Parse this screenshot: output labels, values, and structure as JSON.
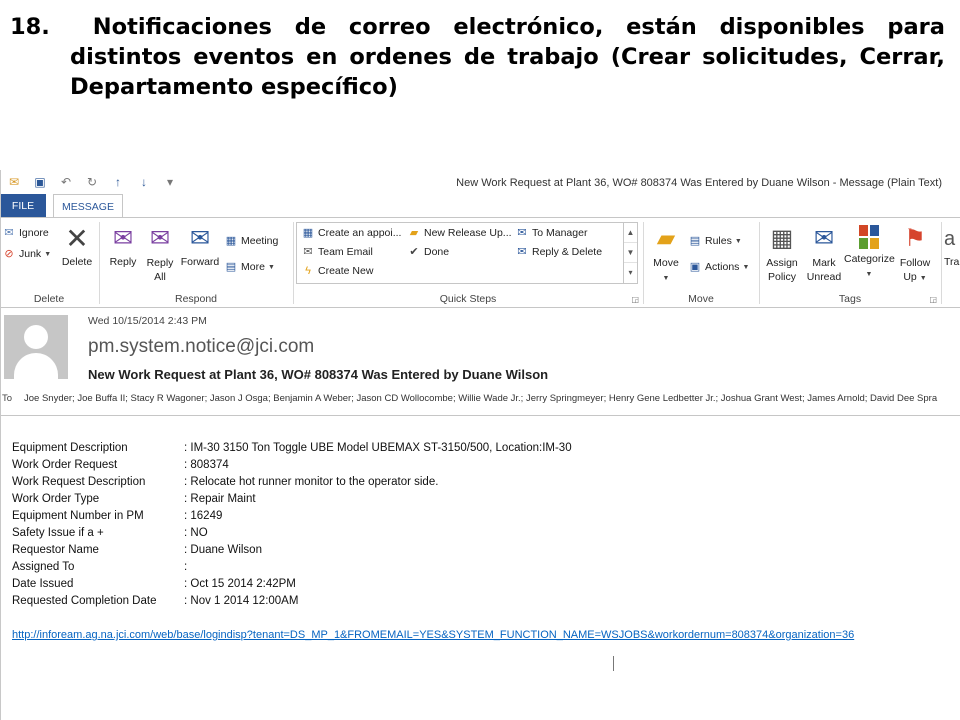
{
  "slide": {
    "line1": [
      "18.",
      "Notificaciones",
      "de",
      "correo",
      "electrónico,",
      "están",
      "disponibles",
      "para"
    ],
    "line2": [
      "distintos",
      "eventos",
      "en",
      "ordenes",
      "de",
      "trabajo",
      "(Crear",
      "solicitudes,",
      "Cerrar,"
    ],
    "line3": "Departamento específico)"
  },
  "window": {
    "title": "New Work Request at Plant 36, WO# 808374 Was Entered by Duane Wilson - Message (Plain Text)"
  },
  "tabs": {
    "file": "FILE",
    "message": "MESSAGE"
  },
  "ribbon": {
    "delete_group": {
      "label": "Delete",
      "ignore": "Ignore",
      "junk": "Junk",
      "delete": "Delete"
    },
    "respond_group": {
      "label": "Respond",
      "reply": "Reply",
      "reply_all_1": "Reply",
      "reply_all_2": "All",
      "forward": "Forward",
      "meeting": "Meeting",
      "more": "More"
    },
    "quick_steps": {
      "label": "Quick Steps",
      "items": [
        "Create an appoi...",
        "Team Email",
        "Create New",
        "New Release Up...",
        "Done",
        "To Manager",
        "Reply & Delete"
      ]
    },
    "move_group": {
      "label": "Move",
      "move": "Move",
      "rules": "Rules",
      "actions": "Actions"
    },
    "tags_group": {
      "label": "Tags",
      "assign_1": "Assign",
      "assign_2": "Policy",
      "mark_1": "Mark",
      "mark_2": "Unread",
      "categorize": "Categorize",
      "follow_1": "Follow",
      "follow_2": "Up",
      "tra": "Tra"
    }
  },
  "message": {
    "date": "Wed 10/15/2014 2:43 PM",
    "from": "pm.system.notice@jci.com",
    "subject": "New Work Request at Plant 36, WO# 808374 Was Entered by Duane Wilson",
    "to_label": "To",
    "to": "Joe Snyder; Joe Buffa II; Stacy R Wagoner; Jason J Osga; Benjamin A Weber; Jason CD Wollocombe; Willie Wade Jr.; Jerry Springmeyer; Henry Gene Ledbetter Jr.; Joshua Grant West; James Arnold; David Dee Spra"
  },
  "body": {
    "fields": [
      {
        "label": "Equipment Description",
        "value": ": IM-30 3150 Ton Toggle UBE Model UBEMAX ST-3150/500, Location:IM-30"
      },
      {
        "label": "Work Order Request",
        "value": ": 808374"
      },
      {
        "label": "Work Request Description",
        "value": ": Relocate hot runner monitor to the operator side."
      },
      {
        "label": "Work Order Type",
        "value": ": Repair Maint"
      },
      {
        "label": "Equipment Number in PM",
        "value": ": 16249"
      },
      {
        "label": "Safety Issue if a +",
        "value": ": NO"
      },
      {
        "label": "Requestor Name",
        "value": ": Duane Wilson"
      },
      {
        "label": "Assigned To",
        "value": ":"
      },
      {
        "label": "Date Issued",
        "value": ": Oct 15 2014  2:42PM"
      },
      {
        "label": "Requested Completion Date",
        "value": ": Nov  1 2014 12:00AM"
      }
    ],
    "link": "http://infoream.ag.na.jci.com/web/base/logindisp?tenant=DS_MP_1&FROMEMAIL=YES&SYSTEM_FUNCTION_NAME=WSJOBS&workordernum=808374&organization=36"
  },
  "colors": {
    "accent": "#2b579a",
    "link": "#0563c1"
  }
}
